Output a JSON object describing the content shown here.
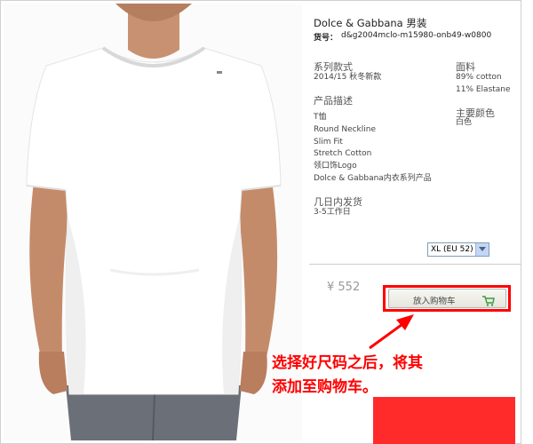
{
  "product": {
    "brand_line": "Dolce & Gabbana 男装",
    "sku_label": "货号：",
    "sku_value": "d&g2004mclo-m15980-onb49-w0800"
  },
  "details": {
    "series_heading": "系列款式",
    "series_value": "2014/15 秋冬新款",
    "fabric_heading": "面料",
    "fabric_lines": [
      "89% cotton",
      "11% Elastane"
    ],
    "desc_heading": "产品描述",
    "desc_lines": [
      "T恤",
      "Round Neckline",
      "Slim Fit",
      "Stretch Cotton",
      "领口饰Logo",
      "Dolce & Gabbana内衣系列产品"
    ],
    "color_heading": "主要颜色",
    "color_value": "白色",
    "ship_heading": "几日内发货",
    "ship_value": "3-5工作日"
  },
  "size_select": {
    "selected": "XL (EU 52)"
  },
  "price": "¥ 552",
  "cart_button": {
    "label": "放入购物车",
    "icon": "shopping-cart-icon"
  },
  "annotation": {
    "line1": "选择好尺码之后，将其",
    "line2": "添加至购物车。"
  },
  "colors": {
    "annotation_red": "#ff0000",
    "highlight_red": "#ff0000",
    "block_red": "#ff2b2b"
  }
}
